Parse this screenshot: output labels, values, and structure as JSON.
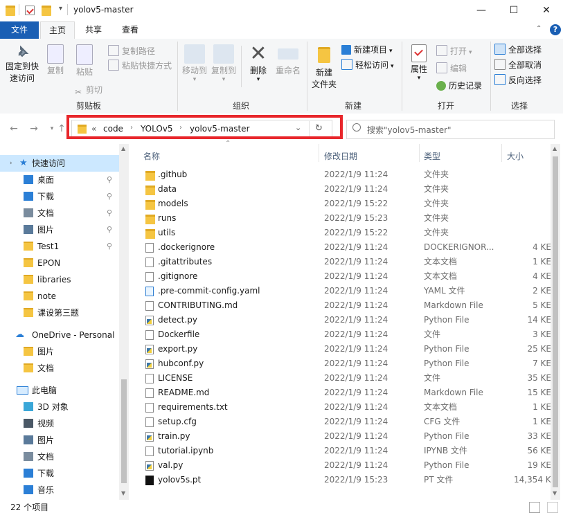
{
  "window": {
    "title": "yolov5-master",
    "minimize": "—",
    "maximize": "☐",
    "close": "✕"
  },
  "ribbon_tabs": [
    "文件",
    "主页",
    "共享",
    "查看"
  ],
  "ribbon": {
    "clipboard": {
      "label": "剪贴板",
      "pin": "固定到快\n速访问",
      "copy": "复制",
      "paste": "粘贴",
      "copy_path": "复制路径",
      "paste_shortcut": "粘贴快捷方式",
      "cut": "剪切"
    },
    "organize": {
      "label": "组织",
      "move_to": "移动到",
      "copy_to": "复制到",
      "delete": "删除",
      "rename": "重命名"
    },
    "new": {
      "label": "新建",
      "new_folder": "新建\n文件夹",
      "new_item": "新建项目",
      "easy_access": "轻松访问"
    },
    "open": {
      "label": "打开",
      "properties": "属性",
      "open": "打开",
      "edit": "编辑",
      "history": "历史记录"
    },
    "select": {
      "label": "选择",
      "select_all": "全部选择",
      "select_none": "全部取消",
      "invert": "反向选择"
    }
  },
  "address": {
    "overflow": "«",
    "crumbs": [
      "code",
      "YOLOv5",
      "yolov5-master"
    ],
    "search_placeholder": "搜索\"yolov5-master\""
  },
  "nav": {
    "quick_access": "快速访问",
    "quick_items": [
      {
        "label": "桌面",
        "pinned": true,
        "icon": "desktop-icon",
        "color": "#2b7fd6"
      },
      {
        "label": "下载",
        "pinned": true,
        "icon": "download-icon",
        "color": "#2b7fd6"
      },
      {
        "label": "文档",
        "pinned": true,
        "icon": "documents-icon",
        "color": "#7a8c9e"
      },
      {
        "label": "图片",
        "pinned": true,
        "icon": "pictures-icon",
        "color": "#5a7a9a"
      },
      {
        "label": "Test1",
        "pinned": true,
        "icon": "folder-icon",
        "color": "#f5c542"
      },
      {
        "label": "EPON",
        "pinned": false,
        "icon": "folder-icon",
        "color": "#f5c542"
      },
      {
        "label": "libraries",
        "pinned": false,
        "icon": "folder-icon",
        "color": "#f5c542"
      },
      {
        "label": "note",
        "pinned": false,
        "icon": "folder-icon",
        "color": "#f5c542"
      },
      {
        "label": "课设第三题",
        "pinned": false,
        "icon": "folder-icon",
        "color": "#f5c542"
      }
    ],
    "onedrive": "OneDrive - Personal",
    "onedrive_items": [
      {
        "label": "图片",
        "icon": "folder-icon",
        "color": "#f5c542"
      },
      {
        "label": "文档",
        "icon": "folder-icon",
        "color": "#f5c542"
      }
    ],
    "this_pc": "此电脑",
    "pc_items": [
      {
        "label": "3D 对象",
        "icon": "3d-objects-icon",
        "color": "#3aa7d8"
      },
      {
        "label": "视频",
        "icon": "video-icon",
        "color": "#4a5866"
      },
      {
        "label": "图片",
        "icon": "pictures-icon",
        "color": "#5a7a9a"
      },
      {
        "label": "文档",
        "icon": "documents-icon",
        "color": "#7a8c9e"
      },
      {
        "label": "下载",
        "icon": "download-icon",
        "color": "#2b7fd6"
      },
      {
        "label": "音乐",
        "icon": "music-icon",
        "color": "#2b7fd6"
      }
    ]
  },
  "columns": {
    "name": "名称",
    "date": "修改日期",
    "type": "类型",
    "size": "大小"
  },
  "files": [
    {
      "name": ".github",
      "date": "2022/1/9 11:24",
      "type": "文件夹",
      "size": "",
      "icon": "folder"
    },
    {
      "name": "data",
      "date": "2022/1/9 11:24",
      "type": "文件夹",
      "size": "",
      "icon": "folder"
    },
    {
      "name": "models",
      "date": "2022/1/9 15:22",
      "type": "文件夹",
      "size": "",
      "icon": "folder"
    },
    {
      "name": "runs",
      "date": "2022/1/9 15:23",
      "type": "文件夹",
      "size": "",
      "icon": "folder"
    },
    {
      "name": "utils",
      "date": "2022/1/9 15:22",
      "type": "文件夹",
      "size": "",
      "icon": "folder"
    },
    {
      "name": ".dockerignore",
      "date": "2022/1/9 11:24",
      "type": "DOCKERIGNOR...",
      "size": "4 KE",
      "icon": "doc"
    },
    {
      "name": ".gitattributes",
      "date": "2022/1/9 11:24",
      "type": "文本文档",
      "size": "1 KE",
      "icon": "doc"
    },
    {
      "name": ".gitignore",
      "date": "2022/1/9 11:24",
      "type": "文本文档",
      "size": "4 KE",
      "icon": "doc"
    },
    {
      "name": ".pre-commit-config.yaml",
      "date": "2022/1/9 11:24",
      "type": "YAML 文件",
      "size": "2 KE",
      "icon": "yaml"
    },
    {
      "name": "CONTRIBUTING.md",
      "date": "2022/1/9 11:24",
      "type": "Markdown File",
      "size": "5 KE",
      "icon": "md"
    },
    {
      "name": "detect.py",
      "date": "2022/1/9 11:24",
      "type": "Python File",
      "size": "14 KE",
      "icon": "py"
    },
    {
      "name": "Dockerfile",
      "date": "2022/1/9 11:24",
      "type": "文件",
      "size": "3 KE",
      "icon": "doc"
    },
    {
      "name": "export.py",
      "date": "2022/1/9 11:24",
      "type": "Python File",
      "size": "25 KE",
      "icon": "py"
    },
    {
      "name": "hubconf.py",
      "date": "2022/1/9 11:24",
      "type": "Python File",
      "size": "7 KE",
      "icon": "py"
    },
    {
      "name": "LICENSE",
      "date": "2022/1/9 11:24",
      "type": "文件",
      "size": "35 KE",
      "icon": "doc"
    },
    {
      "name": "README.md",
      "date": "2022/1/9 11:24",
      "type": "Markdown File",
      "size": "15 KE",
      "icon": "md"
    },
    {
      "name": "requirements.txt",
      "date": "2022/1/9 11:24",
      "type": "文本文档",
      "size": "1 KE",
      "icon": "doc"
    },
    {
      "name": "setup.cfg",
      "date": "2022/1/9 11:24",
      "type": "CFG 文件",
      "size": "1 KE",
      "icon": "doc"
    },
    {
      "name": "train.py",
      "date": "2022/1/9 11:24",
      "type": "Python File",
      "size": "33 KE",
      "icon": "py"
    },
    {
      "name": "tutorial.ipynb",
      "date": "2022/1/9 11:24",
      "type": "IPYNB 文件",
      "size": "56 KE",
      "icon": "doc"
    },
    {
      "name": "val.py",
      "date": "2022/1/9 11:24",
      "type": "Python File",
      "size": "19 KE",
      "icon": "py"
    },
    {
      "name": "yolov5s.pt",
      "date": "2022/1/9 15:23",
      "type": "PT 文件",
      "size": "14,354 KE",
      "icon": "pt"
    }
  ],
  "status": {
    "item_count": "22 个项目"
  },
  "colors": {
    "accent": "#1a5fb4",
    "highlight_border": "#e8262b",
    "folder": "#f5c542"
  }
}
